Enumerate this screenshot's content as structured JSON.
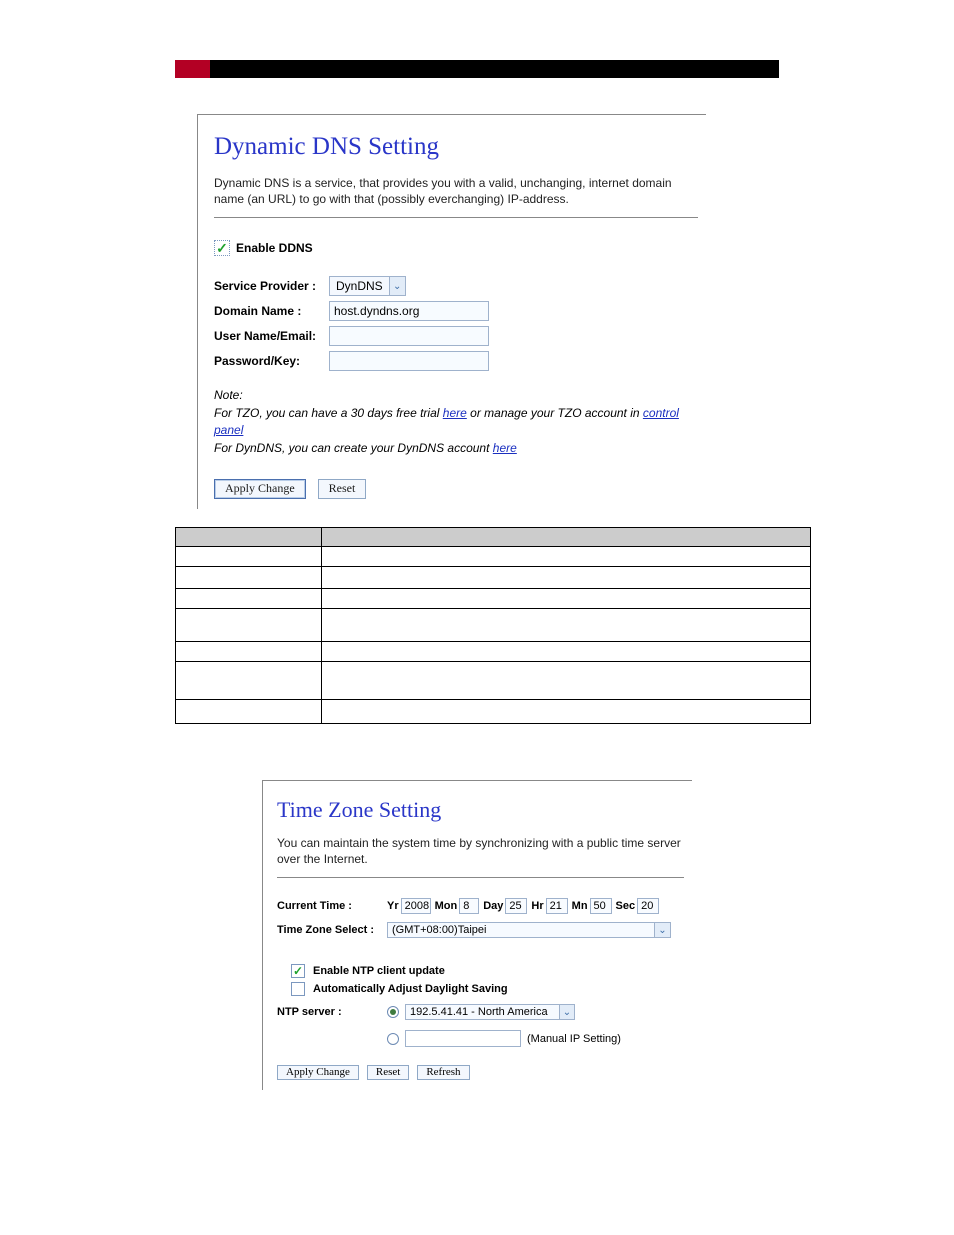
{
  "ddns": {
    "title": "Dynamic DNS  Setting",
    "desc": "Dynamic DNS is a service, that provides you with a valid, unchanging, internet domain name (an URL) to go with that (possibly everchanging) IP-address.",
    "enable_label": "Enable DDNS",
    "provider_label": "Service Provider :",
    "provider_value": "DynDNS",
    "domain_label": "Domain Name :",
    "domain_value": "host.dyndns.org",
    "user_label": "User Name/Email:",
    "pass_label": "Password/Key:",
    "note_label": "Note:",
    "note_line1a": "For TZO, you can have a 30 days free trial ",
    "note_link1": "here",
    "note_line1b": " or manage your TZO account in ",
    "note_link2": "control panel",
    "note_line2a": "For DynDNS, you can create your DynDNS account ",
    "note_link3": "here",
    "apply": "Apply Change",
    "reset": "Reset"
  },
  "tz": {
    "title": "Time Zone Setting",
    "desc": "You can maintain the system time by synchronizing with a public time server over the Internet.",
    "current_label": "Current Time :",
    "yr_l": "Yr",
    "yr_v": "2008",
    "mo_l": "Mon",
    "mo_v": "8",
    "da_l": "Day",
    "da_v": "25",
    "hr_l": "Hr",
    "hr_v": "21",
    "mn_l": "Mn",
    "mn_v": "50",
    "sc_l": "Sec",
    "sc_v": "20",
    "tz_label": "Time Zone Select :",
    "tz_value": "(GMT+08:00)Taipei",
    "ntp_enable": "Enable NTP client update",
    "dst": "Automatically Adjust Daylight Saving",
    "ntp_label": "NTP server :",
    "ntp_value": "192.5.41.41 - North America",
    "manual": "(Manual IP Setting)",
    "apply": "Apply Change",
    "reset": "Reset",
    "refresh": "Refresh"
  }
}
